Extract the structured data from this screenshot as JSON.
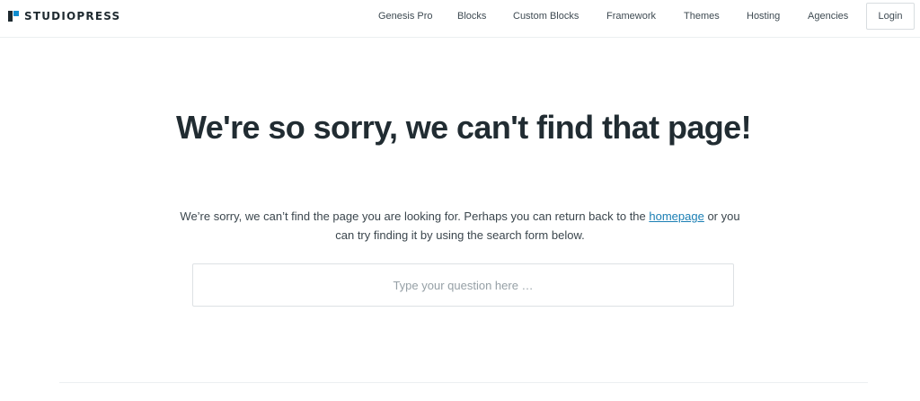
{
  "brand": {
    "name": "STUDIOPRESS",
    "colors": {
      "mark_dark": "#1f2a30",
      "mark_accent": "#0f8ccf"
    }
  },
  "nav": {
    "items": [
      {
        "label": "Genesis Pro"
      },
      {
        "label": "Blocks"
      },
      {
        "label": "Custom Blocks"
      },
      {
        "label": "Framework"
      },
      {
        "label": "Themes"
      },
      {
        "label": "Hosting"
      },
      {
        "label": "Agencies"
      }
    ],
    "login_label": "Login"
  },
  "main": {
    "headline": "We're so sorry, we can't find that page!",
    "message_before": "We’re sorry, we can’t find the page you are looking for. Perhaps you can return back to the ",
    "message_link": "homepage",
    "message_after": " or you can try finding it by using the search form below.",
    "search_placeholder": "Type your question here …",
    "link_color": "#1b7fb4"
  }
}
